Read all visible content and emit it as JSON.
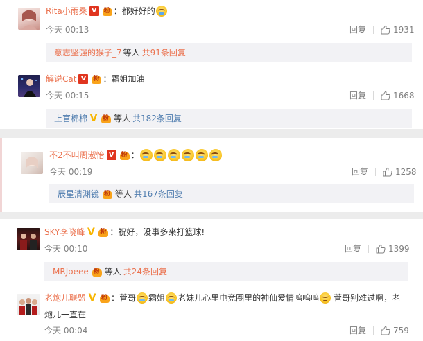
{
  "comments": [
    {
      "username": "Rita小雨桑",
      "sep": "：",
      "text_parts": [
        "都好好的",
        ""
      ],
      "time": "今天 00:13",
      "reply_label": "回复",
      "likes": "1931",
      "replies": {
        "who": "意志坚强的猴子_7",
        "deng": "等人",
        "more": "共91条回复"
      }
    },
    {
      "username": "解说Cat",
      "sep": "：",
      "text_parts": [
        "霜姐加油"
      ],
      "time": "今天 00:15",
      "reply_label": "回复",
      "likes": "1668",
      "replies": {
        "who": "上官棉棉",
        "deng": "等人",
        "more": "共182条回复"
      }
    },
    {
      "username": "不2不叫周淑怡",
      "sep": "：",
      "emoji_count": 6,
      "time": "今天 00:19",
      "reply_label": "回复",
      "likes": "1258",
      "replies": {
        "who": "辰星清渊镜",
        "deng": "等人",
        "more": "共167条回复"
      }
    },
    {
      "username": "SKY李晓峰",
      "sep": "：",
      "text_parts": [
        "祝好，没事多来打篮球!"
      ],
      "time": "今天 00:10",
      "reply_label": "回复",
      "likes": "1399",
      "replies": {
        "who": "MRJoeee",
        "deng": "等人",
        "more": "共24条回复"
      }
    },
    {
      "username": "老炮儿联盟",
      "sep": "：",
      "text_parts": [
        "菅哥",
        "霜姐",
        "老妹儿心里电竞圈里的神仙爱情呜呜呜",
        "菅哥别难过啊，老"
      ],
      "text_line2": "炮儿一直在",
      "time": "今天 00:04",
      "reply_label": "回复",
      "likes": "759"
    }
  ],
  "badges": {
    "v_label": "V",
    "fan_label": "粉"
  },
  "icons": [
    "like-icon",
    "crying-emoji-icon",
    "sad-emoji-icon",
    "v-badge-icon",
    "fan-badge-icon"
  ],
  "colors": {
    "username": "#eb7350",
    "reply_link": "#507daf",
    "meta": "#808080",
    "subbox_bg": "#f2f2f5",
    "gap": "#ececec"
  }
}
